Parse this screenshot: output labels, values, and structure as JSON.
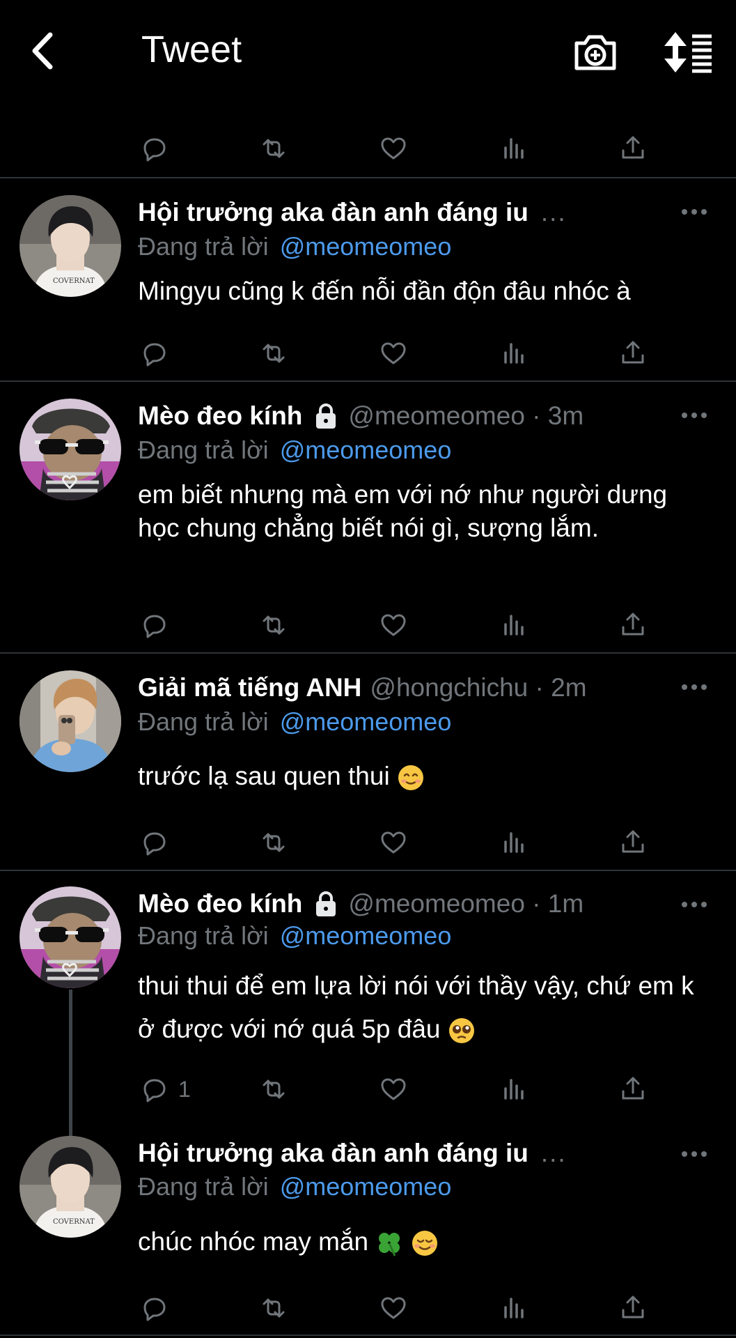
{
  "header": {
    "title": "Tweet"
  },
  "icons": {
    "back": "back-arrow-icon",
    "camera": "camera-add-icon",
    "sort": "sort-icon"
  },
  "colors": {
    "background": "#000000",
    "text": "#e7e9ea",
    "muted": "#71767b",
    "link": "#4c9aeb",
    "divider": "#2f3336"
  },
  "tweets": [
    {
      "name": "Hội trưởng aka đàn anh đáng iu",
      "handle": "",
      "time": "",
      "truncated": "...",
      "replying_label": "Đang trả lời",
      "replying_to": "@meomeomeo",
      "text": "Mingyu cũng k đến nỗi đần độn đâu nhóc à",
      "reply_count": ""
    },
    {
      "name": "Mèo đeo kính",
      "handle": "@meomeomeo · 3m",
      "replying_label": "Đang trả lời",
      "replying_to": "@meomeomeo",
      "text": "em biết nhưng mà em với nớ như người dưng học chung chẳng biết nói gì, sượng lắm.",
      "reply_count": ""
    },
    {
      "name": "Giải mã tiếng ANH",
      "handle": "@hongchichu · 2m",
      "replying_label": "Đang trả lời",
      "replying_to": "@meomeomeo",
      "text": "trước lạ sau quen thui",
      "emoji": "smiling-face-emoji",
      "reply_count": ""
    },
    {
      "name": "Mèo đeo kính",
      "handle": "@meomeomeo · 1m",
      "replying_label": "Đang trả lời",
      "replying_to": "@meomeomeo",
      "text": "thui thui để em lựa lời nói với thầy vậy, chứ em k ở được với nớ quá 5p đâu",
      "emoji": "pleading-face-emoji",
      "reply_count": "1"
    },
    {
      "name": "Hội trưởng aka đàn anh đáng iu",
      "truncated": "...",
      "replying_label": "Đang trả lời",
      "replying_to": "@meomeomeo",
      "text": "chúc nhóc may mắn",
      "emoji": "four-leaf-clover-emoji, relieved-face-emoji",
      "reply_count": ""
    }
  ]
}
